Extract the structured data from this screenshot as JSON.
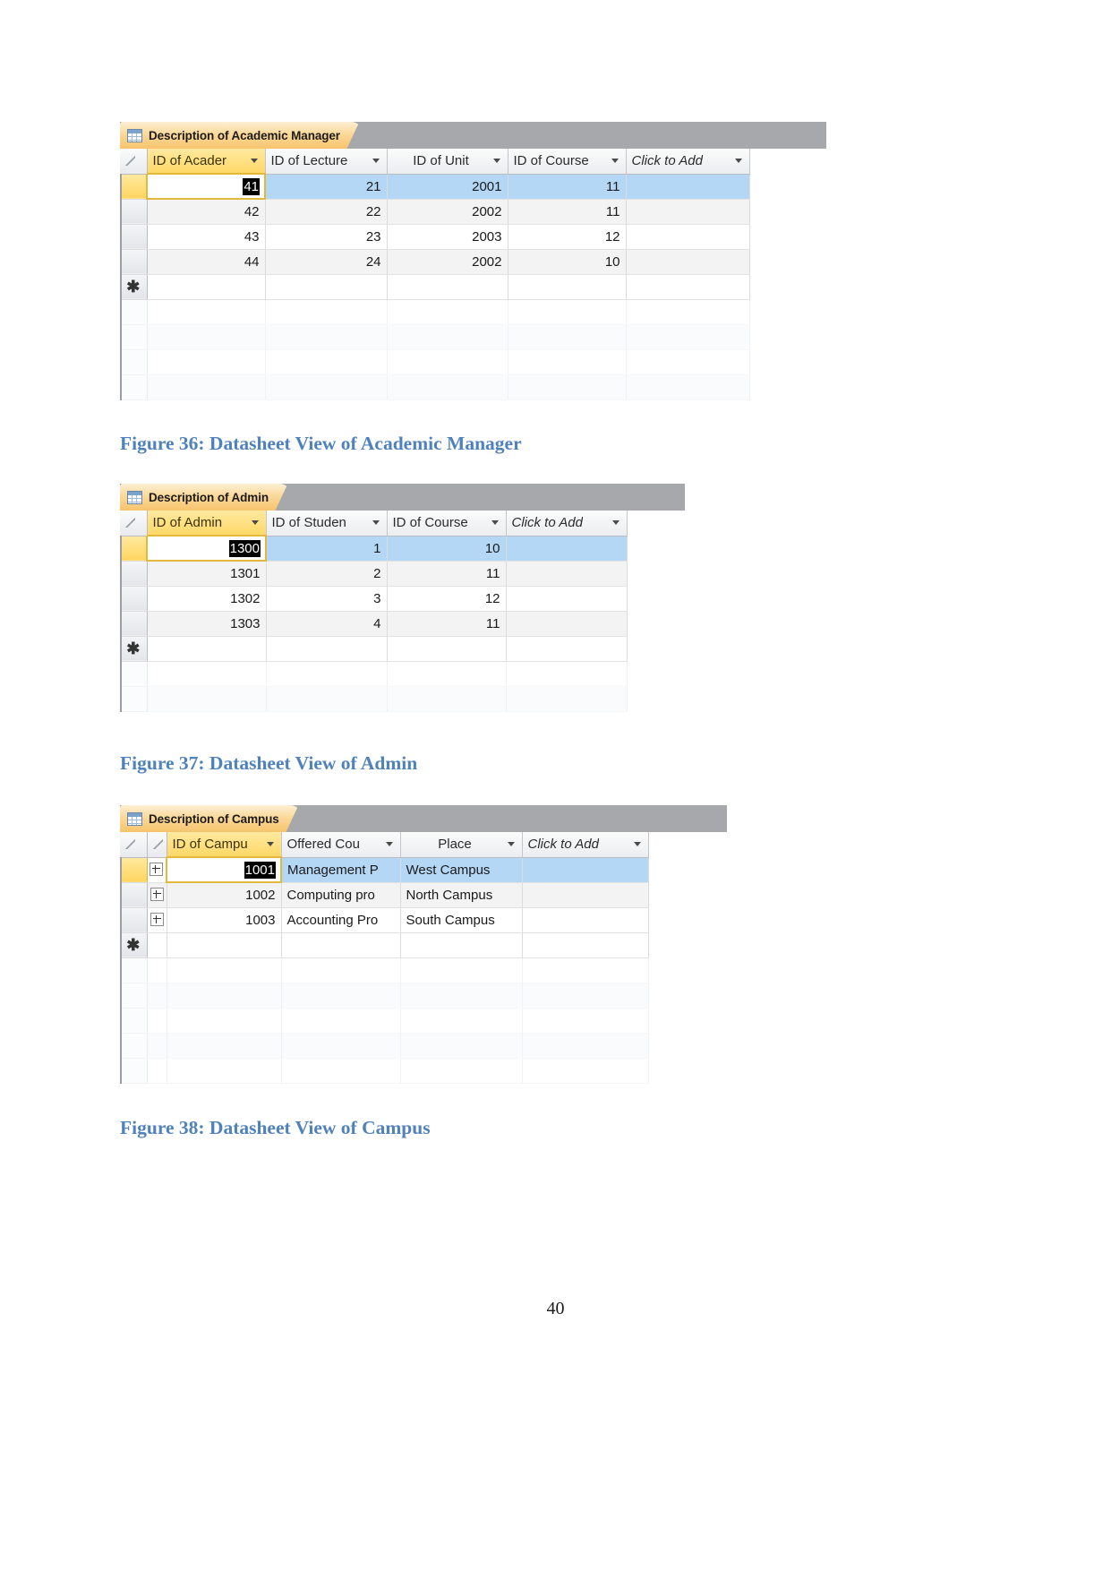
{
  "document": {
    "page_number": "40"
  },
  "figures": [
    {
      "tab_title": "Description of Academic Manager",
      "caption": "Figure 36: Datasheet View of Academic Manager",
      "columns": [
        "ID of Acader",
        "ID of Lecture",
        "ID of Unit",
        "ID of Course",
        "Click to Add"
      ],
      "rows": [
        [
          "41",
          "21",
          "2001",
          "11",
          ""
        ],
        [
          "42",
          "22",
          "2002",
          "11",
          ""
        ],
        [
          "43",
          "23",
          "2003",
          "12",
          ""
        ],
        [
          "44",
          "24",
          "2002",
          "10",
          ""
        ]
      ],
      "new_record_marker": "✱",
      "selected_cell_value": "41"
    },
    {
      "tab_title": "Description of Admin",
      "caption": "Figure 37: Datasheet View of Admin",
      "columns": [
        "ID of Admin",
        "ID of Studen",
        "ID of Course",
        "Click to Add"
      ],
      "rows": [
        [
          "1300",
          "1",
          "10",
          ""
        ],
        [
          "1301",
          "2",
          "11",
          ""
        ],
        [
          "1302",
          "3",
          "12",
          ""
        ],
        [
          "1303",
          "4",
          "11",
          ""
        ]
      ],
      "new_record_marker": "✱",
      "selected_cell_value": "1300"
    },
    {
      "tab_title": "Description of Campus",
      "caption": "Figure 38: Datasheet View of Campus",
      "columns": [
        "ID of Campu",
        "Offered Cou",
        "Place",
        "Click to Add"
      ],
      "rows": [
        [
          "1001",
          "Management P",
          "West Campus",
          ""
        ],
        [
          "1002",
          "Computing pro",
          "North Campus",
          ""
        ],
        [
          "1003",
          "Accounting Pro",
          "South Campus",
          ""
        ]
      ],
      "new_record_marker": "✱",
      "selected_cell_value": "1001"
    }
  ],
  "colors": {
    "caption_blue": "#4f81bd",
    "tab_orange": "#f7c46c",
    "header_yellow": "#ffd867",
    "selected_row_blue": "#b4d7f5",
    "tabstrip_gray": "#a6a8ab"
  }
}
